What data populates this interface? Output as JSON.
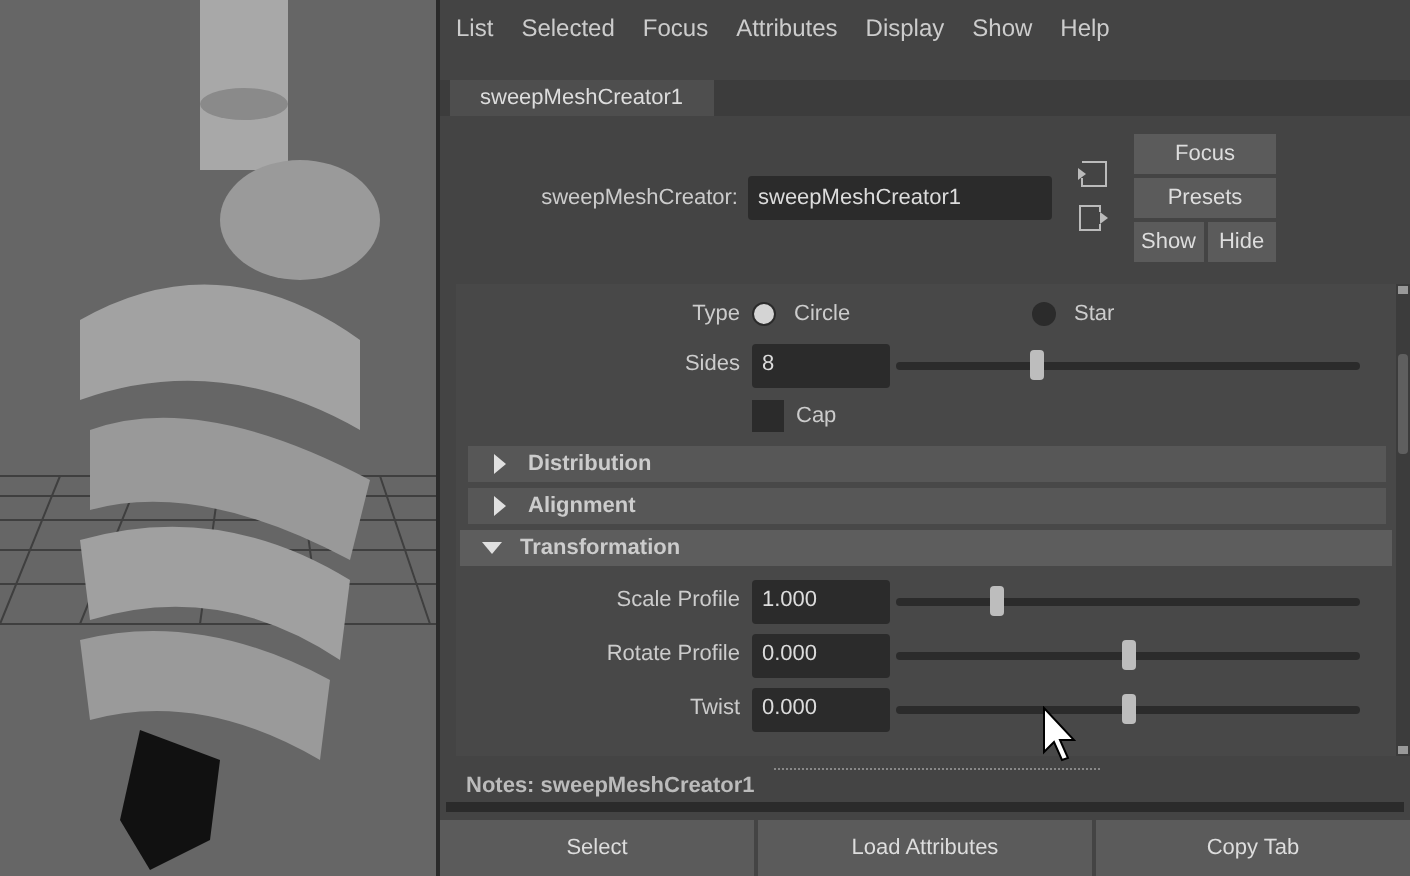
{
  "menu": [
    "List",
    "Selected",
    "Focus",
    "Attributes",
    "Display",
    "Show",
    "Help"
  ],
  "tabs": [
    {
      "label": "sweepMeshCreator1",
      "selected": true
    }
  ],
  "node": {
    "label": "sweepMeshCreator:",
    "value": "sweepMeshCreator1"
  },
  "side_buttons": [
    "Focus",
    "Presets",
    "Show",
    "Hide"
  ],
  "attributes": [
    {
      "kind": "radio",
      "label": "Type",
      "options": [
        {
          "label": "Circle",
          "selected": true
        },
        {
          "label": "Star",
          "selected": false
        }
      ]
    },
    {
      "kind": "slider",
      "label": "Sides",
      "value": "8",
      "level": 0.3
    },
    {
      "kind": "checkbox",
      "label": "Cap",
      "checked": false
    }
  ],
  "sections": [
    {
      "label": "Distribution",
      "expanded": false
    },
    {
      "label": "Alignment",
      "expanded": false
    },
    {
      "label": "Transformation",
      "expanded": true,
      "attributes": [
        {
          "kind": "slider",
          "label": "Scale Profile",
          "value": "1.000",
          "level": 0.215
        },
        {
          "kind": "slider",
          "label": "Rotate Profile",
          "value": "0.000",
          "level": 0.5
        },
        {
          "kind": "slider",
          "label": "Twist",
          "value": "0.000",
          "level": 0.5
        }
      ]
    }
  ],
  "notes": "Notes:  sweepMeshCreator1",
  "bottom_buttons": [
    "Select",
    "Load Attributes",
    "Copy Tab"
  ]
}
